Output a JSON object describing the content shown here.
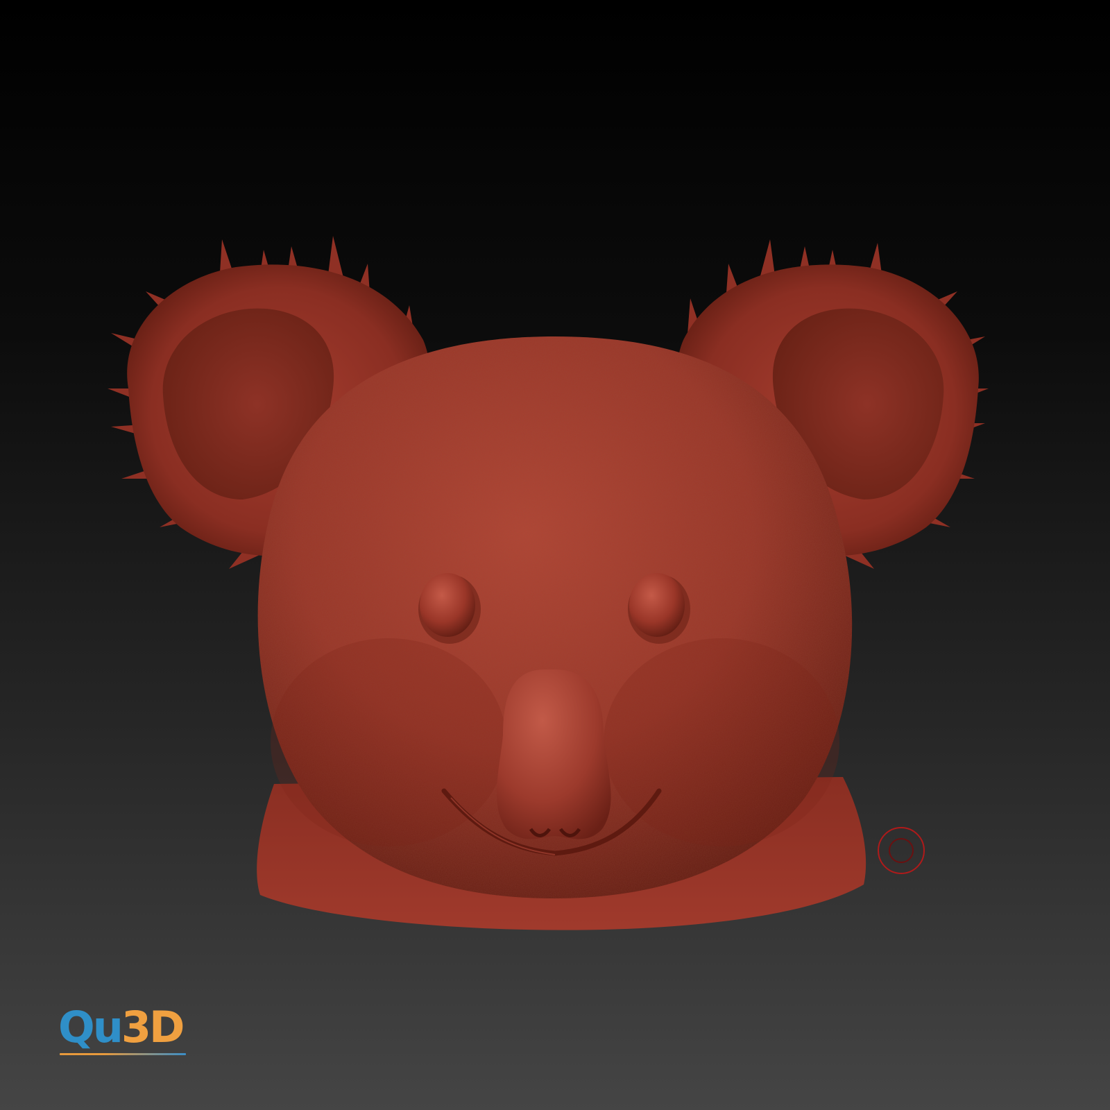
{
  "viewport": {
    "background_top": "#000000",
    "background_bottom": "#454545"
  },
  "model": {
    "material_color": "#a0392c",
    "shadow_color": "#4a130d",
    "highlight_color": "#c8553f"
  },
  "gizmo": {
    "icon": "navigation-gizmo-icon",
    "color": "#b01a1a"
  },
  "logo": {
    "part1": "Qu",
    "part2": "3D",
    "color1": "#2f8fc8",
    "color2": "#f0a040"
  }
}
